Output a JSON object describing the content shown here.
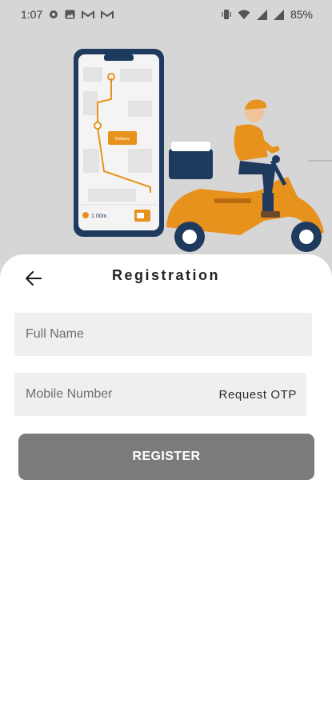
{
  "status_bar": {
    "time": "1:07",
    "battery": "85%"
  },
  "hero": {
    "map_tag": "Delivery",
    "distance": "1 00m"
  },
  "header": {
    "title": "Registration"
  },
  "form": {
    "full_name_placeholder": "Full Name",
    "mobile_placeholder": "Mobile Number",
    "request_otp_label": "Request OTP",
    "register_label": "REGISTER"
  },
  "colors": {
    "accent_orange": "#E8921E",
    "navy": "#1F3A5F",
    "button_gray": "#7b7b7b",
    "field_bg": "#efefef"
  },
  "icons": [
    "back-arrow-icon",
    "wifi-icon",
    "signal-icon",
    "battery-icon",
    "vibrate-icon"
  ]
}
